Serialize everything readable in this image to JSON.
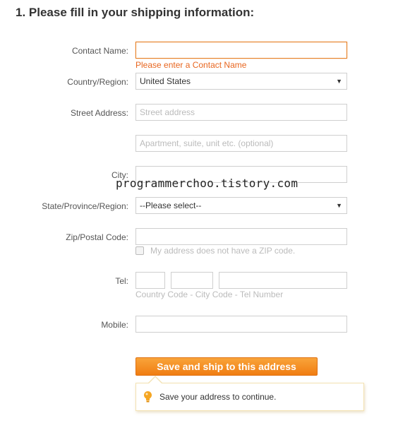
{
  "heading": "1. Please fill in your shipping information:",
  "contact": {
    "label": "Contact Name:",
    "value": "",
    "error": "Please enter a Contact Name"
  },
  "country": {
    "label": "Country/Region:",
    "selected": "United States"
  },
  "street": {
    "label": "Street Address:",
    "placeholder": "Street address",
    "placeholder2": "Apartment, suite, unit etc. (optional)"
  },
  "city": {
    "label": "City:"
  },
  "state": {
    "label": "State/Province/Region:",
    "selected": "--Please select--"
  },
  "zip": {
    "label": "Zip/Postal Code:",
    "no_zip_checkbox_label": "My address does not have a ZIP code.",
    "no_zip_checked": false
  },
  "tel": {
    "label": "Tel:",
    "hint": "Country Code - City Code - Tel Number"
  },
  "mobile": {
    "label": "Mobile:"
  },
  "save_button": "Save and ship to this address",
  "tooltip": {
    "text": "Save your address to continue.",
    "icon": "lightbulb-icon"
  },
  "watermark": "programmerchoo.tistory.com",
  "colors": {
    "accent": "#f08a1c",
    "error": "#e8661f"
  }
}
